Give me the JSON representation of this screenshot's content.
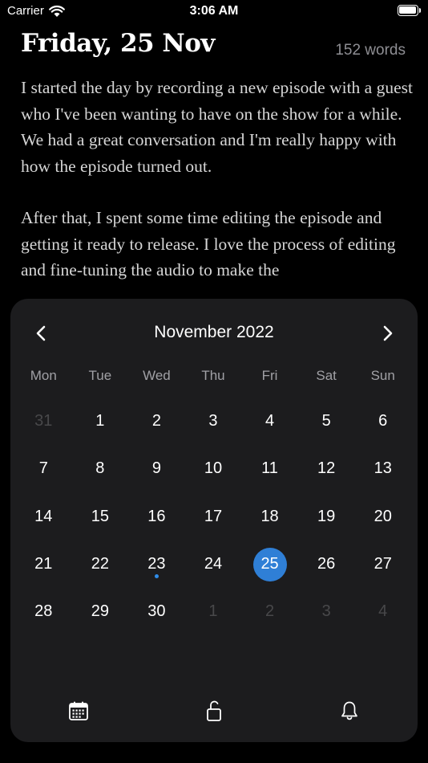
{
  "status": {
    "carrier": "Carrier",
    "time": "3:06 AM"
  },
  "entry": {
    "date_title": "Friday, 25 Nov",
    "word_count": "152 words",
    "paragraphs": [
      "I started the day by recording a new episode with a guest who I've been wanting to have on the show for a while. We had a great conversation and I'm really happy with how the episode turned out.",
      "After that, I spent some time editing the episode and getting it ready to release. I love the process of editing and fine-tuning the audio to make the"
    ]
  },
  "calendar": {
    "month_label": "November 2022",
    "weekdays": [
      "Mon",
      "Tue",
      "Wed",
      "Thu",
      "Fri",
      "Sat",
      "Sun"
    ],
    "days": [
      {
        "n": "31",
        "muted": true
      },
      {
        "n": "1"
      },
      {
        "n": "2"
      },
      {
        "n": "3"
      },
      {
        "n": "4"
      },
      {
        "n": "5"
      },
      {
        "n": "6"
      },
      {
        "n": "7"
      },
      {
        "n": "8"
      },
      {
        "n": "9"
      },
      {
        "n": "10"
      },
      {
        "n": "11"
      },
      {
        "n": "12"
      },
      {
        "n": "13"
      },
      {
        "n": "14"
      },
      {
        "n": "15"
      },
      {
        "n": "16"
      },
      {
        "n": "17"
      },
      {
        "n": "18"
      },
      {
        "n": "19"
      },
      {
        "n": "20"
      },
      {
        "n": "21"
      },
      {
        "n": "22"
      },
      {
        "n": "23",
        "dot": true
      },
      {
        "n": "24"
      },
      {
        "n": "25",
        "selected": true
      },
      {
        "n": "26"
      },
      {
        "n": "27"
      },
      {
        "n": "28"
      },
      {
        "n": "29"
      },
      {
        "n": "30"
      },
      {
        "n": "1",
        "muted": true
      },
      {
        "n": "2",
        "muted": true
      },
      {
        "n": "3",
        "muted": true
      },
      {
        "n": "4",
        "muted": true
      }
    ],
    "selected_color": "#2f7fd6",
    "entry_dot_color": "#2f8ce8"
  },
  "toolbar": {
    "icons": [
      "calendar-icon",
      "unlock-icon",
      "bell-icon"
    ]
  }
}
